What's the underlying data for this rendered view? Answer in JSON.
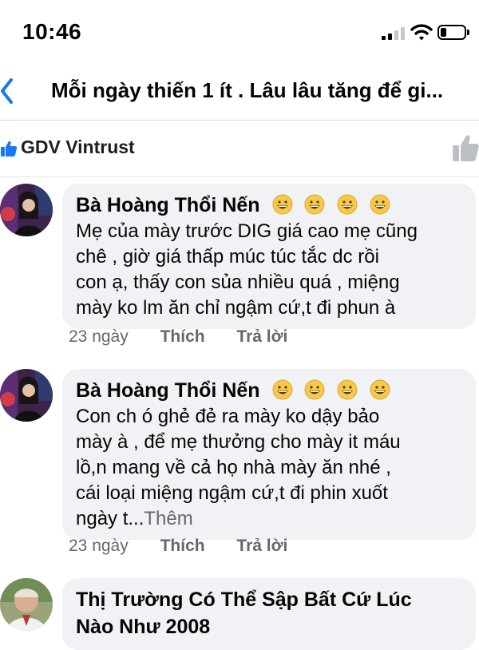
{
  "status_bar": {
    "time": "10:46",
    "battery_level": 0.25
  },
  "header": {
    "title": "Mỗi ngày thiến 1 ít . Lâu lâu tăng để gi..."
  },
  "page": {
    "name": "GDV Vintrust"
  },
  "comments": [
    {
      "author": "Bà Hoàng Thổi Nến",
      "author_emojis": [
        "grinning-face-icon",
        "grinning-face-icon",
        "grinning-face-icon",
        "grinning-face-icon"
      ],
      "text_lines": [
        "Mẹ của mày trước DIG giá cao mẹ cũng",
        "chê , giờ giá thấp múc túc tắc dc rồi",
        "con ạ, thấy con sủa nhiều quá , miệng",
        "mày ko lm ăn chỉ ngậm cứ,t đi phun à"
      ],
      "time": "23 ngày",
      "like_label": "Thích",
      "reply_label": "Trả lời"
    },
    {
      "author": "Bà Hoàng Thổi Nến",
      "author_emojis": [
        "grinning-face-icon",
        "grinning-face-icon",
        "grinning-face-icon",
        "grinning-face-icon"
      ],
      "text_lines": [
        "Con ch ó ghẻ đẻ ra mày ko dậy bảo",
        "mày à , để mẹ thưởng cho mày it máu",
        "lồ,n mang về cả họ nhà mày ăn nhé ,",
        "cái loại miệng ngậm cứ,t đi phin xuốt",
        "ngày t..."
      ],
      "see_more": "Thêm",
      "time": "23 ngày",
      "like_label": "Thích",
      "reply_label": "Trả lời"
    },
    {
      "author_lines": [
        "Thị Trường Có Thể Sập Bất Cứ Lúc",
        "Nào Như 2008"
      ]
    }
  ],
  "colors": {
    "accent": "#1877f2",
    "bubble": "#f0f2f5",
    "muted": "#65676b"
  }
}
